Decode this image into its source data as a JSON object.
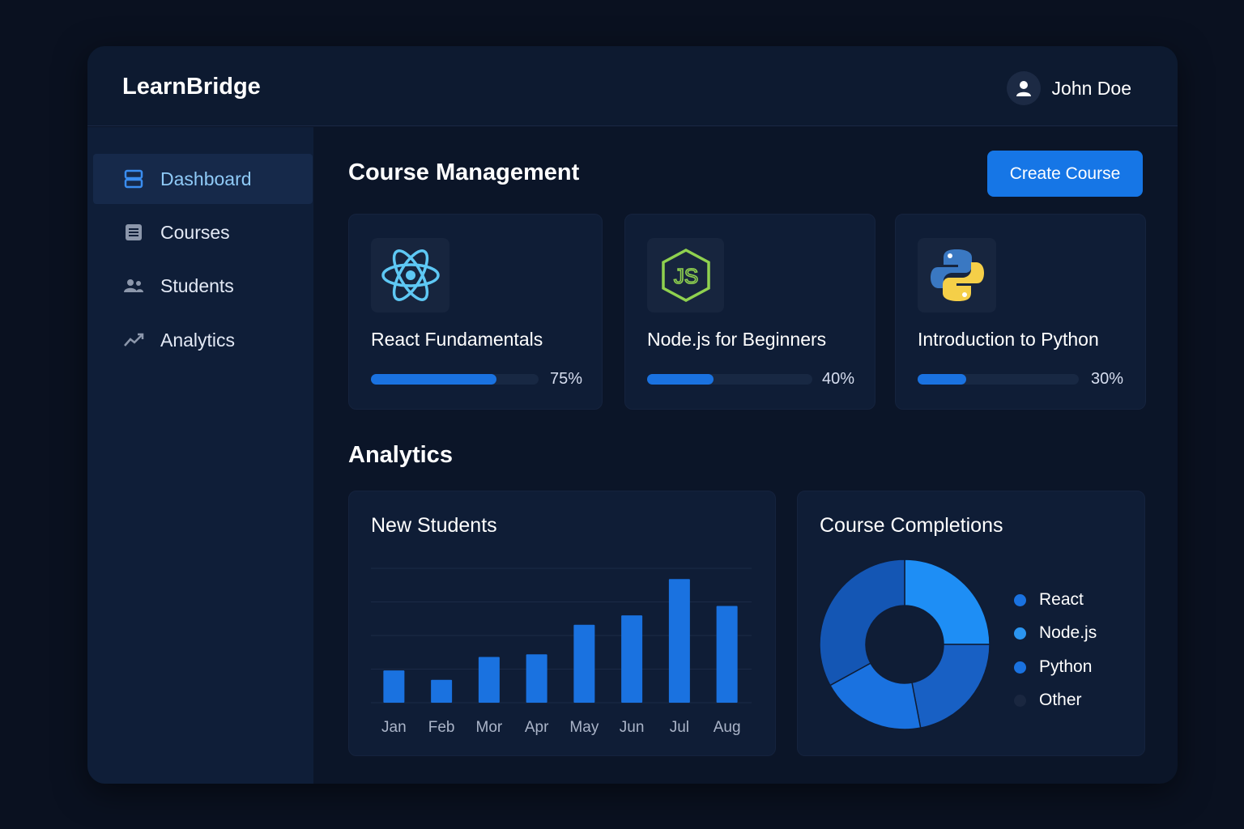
{
  "app": {
    "brand": "LearnBridge"
  },
  "user": {
    "name": "John Doe"
  },
  "sidebar": {
    "items": [
      {
        "label": "Dashboard",
        "icon": "dashboard-icon",
        "active": true
      },
      {
        "label": "Courses",
        "icon": "list-icon"
      },
      {
        "label": "Students",
        "icon": "users-icon"
      },
      {
        "label": "Analytics",
        "icon": "trend-icon"
      }
    ]
  },
  "courses": {
    "heading": "Course Management",
    "create_label": "Create Course",
    "items": [
      {
        "title": "React Fundamentals",
        "progress": 0.75,
        "progress_label": "75%",
        "icon": "react-icon"
      },
      {
        "title": "Node.js for Beginners",
        "progress": 0.4,
        "progress_label": "40%",
        "icon": "nodejs-icon"
      },
      {
        "title": "Introduction to Python",
        "progress": 0.3,
        "progress_label": "30%",
        "icon": "python-icon"
      }
    ]
  },
  "analytics": {
    "heading": "Analytics",
    "new_students_title": "New Students",
    "completions_title": "Course Completions"
  },
  "chart_data": [
    {
      "type": "bar",
      "title": "New Students",
      "categories": [
        "Jan",
        "Feb",
        "Mor",
        "Apr",
        "May",
        "Jun",
        "Jul",
        "Aug"
      ],
      "values": [
        24,
        17,
        34,
        36,
        58,
        65,
        92,
        72
      ],
      "ylim": [
        0,
        100
      ],
      "grid": true,
      "color": "#1a72e0"
    },
    {
      "type": "pie",
      "title": "Course Completions",
      "categories": [
        "React",
        "Node.js",
        "Python",
        "Other"
      ],
      "values": [
        25,
        22,
        20,
        33
      ],
      "colors": [
        "#1e8ef5",
        "#1860c4",
        "#1a72e0",
        "#1456b4"
      ],
      "legend_colors": [
        "#1a72e0",
        "#2b95f0",
        "#1a72e0",
        "#1a2740"
      ],
      "legend": "right"
    }
  ]
}
